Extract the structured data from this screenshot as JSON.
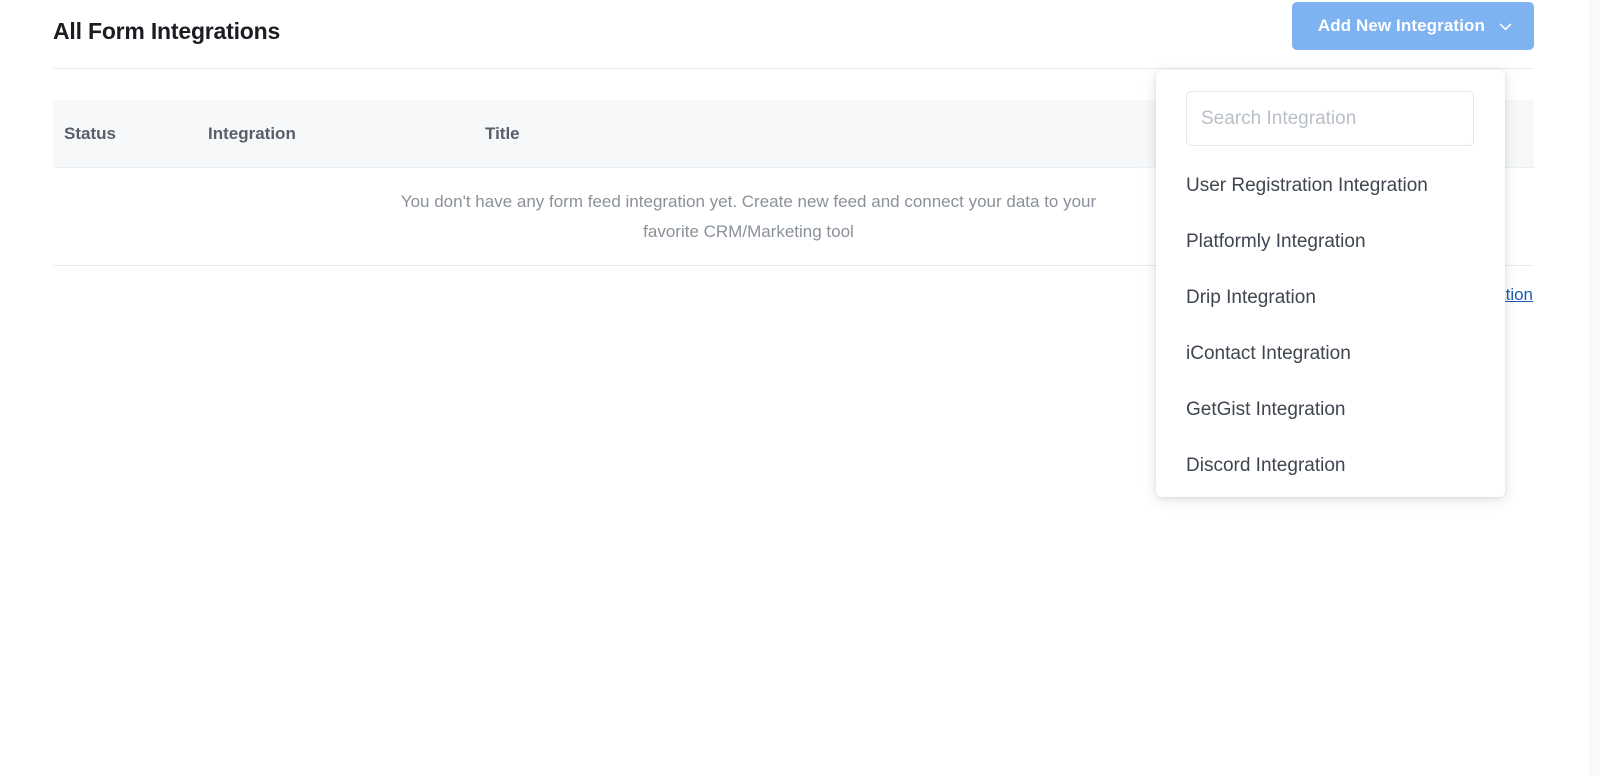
{
  "header": {
    "title": "All Form Integrations",
    "add_button_label": "Add New Integration",
    "add_button_icon": "chevron-down-icon",
    "accent_color": "#7eb2f0"
  },
  "table": {
    "columns": [
      "Status",
      "Integration",
      "Title"
    ],
    "empty_message": "You don't have any form feed integration yet. Create new feed and connect your data to your favorite CRM/Marketing tool",
    "header_background": "#f6f8f9"
  },
  "footer": {
    "global_link_label": "Check Global Integration",
    "link_color": "#1a5fb4"
  },
  "dropdown": {
    "search": {
      "placeholder": "Search Integration",
      "value": ""
    },
    "items": [
      {
        "label": "User Registration Integration"
      },
      {
        "label": "Platformly Integration"
      },
      {
        "label": "Drip Integration"
      },
      {
        "label": "iContact Integration"
      },
      {
        "label": "GetGist Integration"
      },
      {
        "label": "Discord Integration"
      }
    ]
  }
}
